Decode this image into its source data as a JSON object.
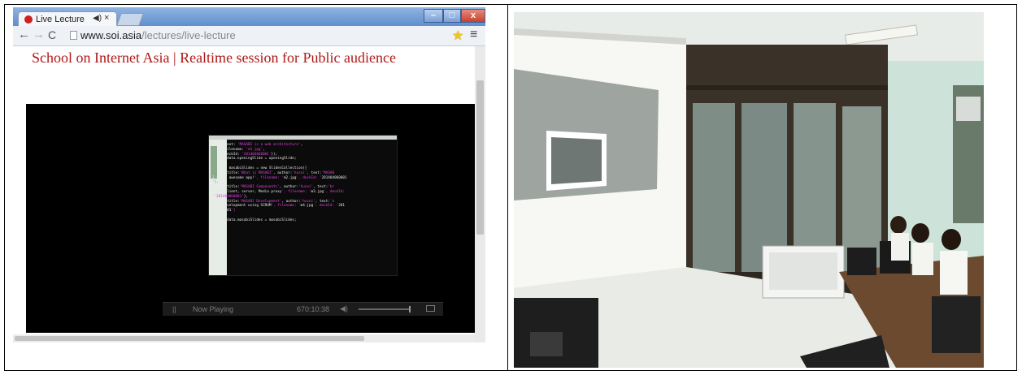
{
  "browser": {
    "tab": {
      "title": "Live Lecture",
      "audio_icon": "speaker-icon",
      "close_symbol": "×"
    },
    "window_controls": {
      "minimize": "–",
      "maximize": "□",
      "close": "x"
    },
    "toolbar": {
      "back": "←",
      "forward": "→",
      "reload": "C",
      "url_host": "www.soi.asia",
      "url_path": "/lectures/live-lecture",
      "bookmark_icon": "star-icon",
      "menu_symbol": "≡"
    },
    "page": {
      "heading": "School on Internet Asia | Realtime session for Public audience"
    },
    "player": {
      "status": "Now Playing",
      "time": "670:10:38",
      "pause_symbol": "||",
      "volume_symbol": "◀)"
    },
    "slide_code": [
      "      text: 'MASABI is a web architecture',",
      "      filename: 'm1.jpg',",
      "      deckId: '201404060001'});",
      "    appdata.openingSlide = openingSlide;",
      "",
      "    var masabiSlides = new SlidesCollection([",
      "      {title:'What is MASABI', author:'husni', text:'MASAB",
      "I is an awesome app!', filename: 'm2.jpg', deckId: '201404060001",
      "'},",
      "      {title:'MASABI Components', author:'husni', text:'br",
      "owser/client, server, Media proxy', filename: 'm3.jpg', deckId:",
      " '201404060001'},",
      "      {title:'MASABI Development', author:'husni', text:'a",
      "gile development using SCRUM', filename: 'm4.jpg', deckId: '201",
      "404060001'}",
      "    ]);",
      "    appdata.masabiSlides = masabiSlides;",
      "});"
    ]
  },
  "colors": {
    "heading_red": "#b01818",
    "titlebar_blue": "#6f9ad3",
    "video_bg": "#000000",
    "code_string": "#e040e0"
  }
}
